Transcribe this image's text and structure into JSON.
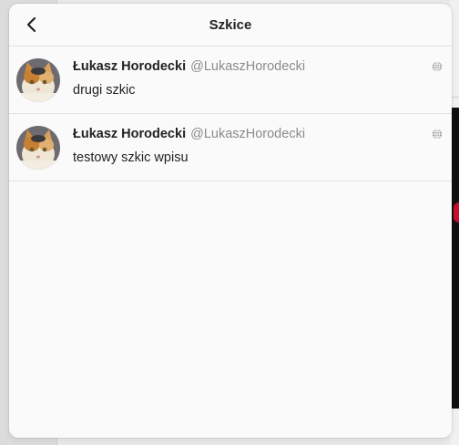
{
  "header": {
    "title": "Szkice"
  },
  "drafts": [
    {
      "author_name": "Łukasz Horodecki",
      "author_handle": "@LukaszHorodecki",
      "text": "drugi szkic",
      "visibility_icon": "globe-icon"
    },
    {
      "author_name": "Łukasz Horodecki",
      "author_handle": "@LukaszHorodecki",
      "text": "testowy szkic wpisu",
      "visibility_icon": "globe-icon"
    }
  ],
  "colors": {
    "modal_background": "#fafafa",
    "divider": "#e2e2e2",
    "handle_text": "#8a8a8a",
    "primary_text": "#222222"
  }
}
